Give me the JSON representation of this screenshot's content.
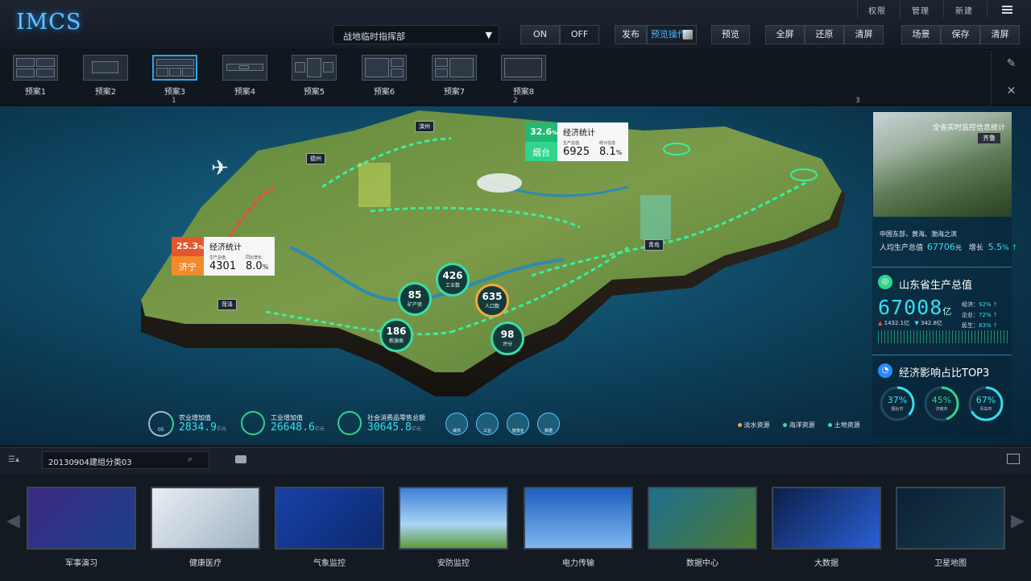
{
  "app": {
    "logo": "IMCS"
  },
  "toplinks": [
    "权限",
    "管理",
    "新建"
  ],
  "header": {
    "command_select": "战地临时指挥部",
    "on_label": "ON",
    "off_label": "OFF",
    "publish_label": "发布",
    "preview_op_label": "预览操作",
    "preview_label": "预览",
    "fullscreen_label": "全屏",
    "restore_label": "还原",
    "clear_label": "清屏",
    "scene_label": "场景",
    "save_label": "保存",
    "clearscreen_label": "清屏"
  },
  "presets": [
    {
      "label": "预案1",
      "num": ""
    },
    {
      "label": "预案2",
      "num": ""
    },
    {
      "label": "预案3",
      "num": "1"
    },
    {
      "label": "预案4",
      "num": ""
    },
    {
      "label": "预案5",
      "num": ""
    },
    {
      "label": "预案6",
      "num": ""
    },
    {
      "label": "预案7",
      "num": ""
    },
    {
      "label": "预案8",
      "num": "2"
    }
  ],
  "preset_extra_num": "3",
  "map": {
    "city_labels": [
      "滨州",
      "德州",
      "菏泽",
      "青岛"
    ],
    "card_jining": {
      "pct": "25.3",
      "pct_unit": "%",
      "city": "济宁",
      "title": "经济统计",
      "k1": "生产总值",
      "v1": "4301",
      "k2": "同比增长",
      "v2": "8.0",
      "v2_unit": "%"
    },
    "card_yantai": {
      "pct": "32.6",
      "pct_unit": "%",
      "city": "烟台",
      "title": "经济统计",
      "k1": "生产总值",
      "v1": "6925",
      "k2": "统计信息",
      "v2": "8.1",
      "v2_unit": "%"
    },
    "bubbles": [
      {
        "num": "85",
        "label": "矿产资"
      },
      {
        "num": "426",
        "label": "工业数"
      },
      {
        "num": "635",
        "label": "人口数"
      },
      {
        "num": "186",
        "label": "新源类"
      },
      {
        "num": "98",
        "label": "评分"
      }
    ],
    "stats": [
      {
        "label": "农业增加值",
        "value": "2834.9",
        "unit": "亿元",
        "small": "05"
      },
      {
        "label": "工业增加值",
        "value": "26648.6",
        "unit": "亿元"
      },
      {
        "label": "社会消费品零售总额",
        "value": "30645.8",
        "unit": "亿元"
      }
    ],
    "icon_labels": [
      "城市",
      "工业",
      "旅游业",
      "数据"
    ],
    "legend": [
      {
        "label": "淡水资源",
        "color": "#f2a93b"
      },
      {
        "label": "海洋资源",
        "color": "#35e0a8"
      },
      {
        "label": "土地资源",
        "color": "#35e0a8"
      }
    ]
  },
  "right": {
    "photo_title": "全省实时监控信息统计",
    "photo_tag": "齐鲁",
    "desc": "中国东部，黄海、渤海之滨",
    "gdp_label": "人均生产总值",
    "gdp_value": "67706",
    "gdp_unit": "元",
    "growth_label": "增长",
    "growth_value": "5.5",
    "growth_unit": "%",
    "province_title": "山东省生产总值",
    "province_value": "67008",
    "province_unit": "亿",
    "sub_up": "1432.1亿",
    "sub_down": "342.8亿",
    "metrics": [
      {
        "label": "经济：",
        "pct": "92%"
      },
      {
        "label": "企业：",
        "pct": "72%"
      },
      {
        "label": "民生：",
        "pct": "83%"
      }
    ],
    "top3_title": "经济影响占比TOP3",
    "top3": [
      {
        "pct": "37%",
        "city": "烟台市",
        "frac": 0.37
      },
      {
        "pct": "45%",
        "city": "济南市",
        "frac": 0.45
      },
      {
        "pct": "67%",
        "city": "青岛市",
        "frac": 0.67
      }
    ]
  },
  "bottom": {
    "search_value": "20130904建组分类03"
  },
  "thumbnails": [
    "军事演习",
    "健康医疗",
    "气象监控",
    "安防监控",
    "电力传输",
    "数据中心",
    "大数据",
    "卫星地图"
  ]
}
